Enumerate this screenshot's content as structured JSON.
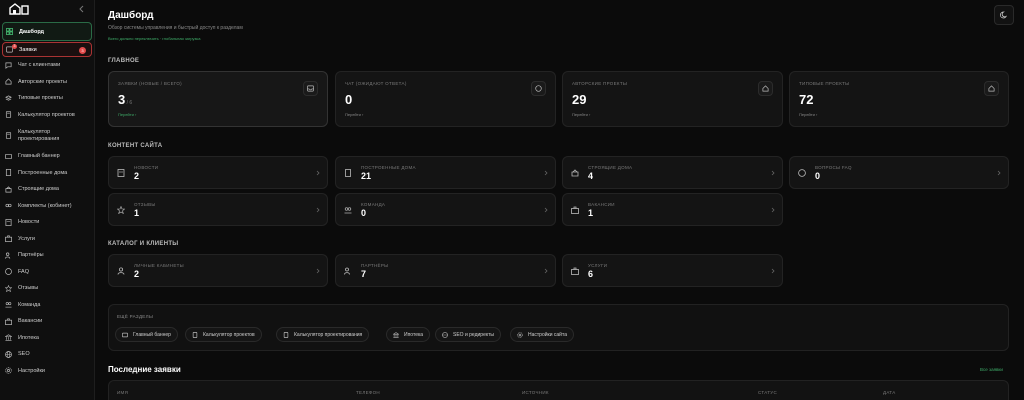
{
  "sidebar": {
    "items": [
      {
        "label": "Дашборд",
        "icon": "dashboard-icon"
      },
      {
        "label": "Заявки",
        "icon": "inbox-icon",
        "badge": "3",
        "count": "3"
      },
      {
        "label": "Чат с клиентами",
        "icon": "chat-icon"
      },
      {
        "label": "Авторские проекты",
        "icon": "home-icon"
      },
      {
        "label": "Типовые проекты",
        "icon": "layers-icon"
      },
      {
        "label": "Калькулятор проектов",
        "icon": "calculator-icon"
      },
      {
        "label": "Калькулятор проектирования",
        "icon": "calculator-icon"
      },
      {
        "label": "Главный баннер",
        "icon": "banner-icon"
      },
      {
        "label": "Построенные дома",
        "icon": "building-icon"
      },
      {
        "label": "Строящие дома",
        "icon": "crane-icon"
      },
      {
        "label": "Комплекты (кобинет)",
        "icon": "box-icon"
      },
      {
        "label": "Новости",
        "icon": "newspaper-icon"
      },
      {
        "label": "Услуги",
        "icon": "briefcase-icon"
      },
      {
        "label": "Партнёры",
        "icon": "users-icon"
      },
      {
        "label": "FAQ",
        "icon": "help-icon"
      },
      {
        "label": "Отзывы",
        "icon": "star-icon"
      },
      {
        "label": "Команда",
        "icon": "team-icon"
      },
      {
        "label": "Вакансии",
        "icon": "briefcase-icon"
      },
      {
        "label": "Ипотека",
        "icon": "bank-icon"
      },
      {
        "label": "SEO",
        "icon": "globe-icon"
      },
      {
        "label": "Настройки",
        "icon": "gear-icon"
      }
    ]
  },
  "header": {
    "title": "Дашборд",
    "subtitle": "Обзор системы управления и быстрый доступ к разделам",
    "update": "Всего должно переключить · глобальная загрузка"
  },
  "sections": {
    "main": "ГЛАВНОЕ",
    "content": "КОНТЕНТ САЙТА",
    "catalog": "КАТАЛОГ И КЛИЕНТЫ"
  },
  "stats": [
    {
      "label": "ЗАЯВКИ (НОВЫЕ / ВСЕГО)",
      "value": "3",
      "sub": "/ 6",
      "more": "Перейти ›"
    },
    {
      "label": "ЧАТ (ОЖИДАЮТ ОТВЕТА)",
      "value": "0",
      "sub": "",
      "more": "Перейти ›"
    },
    {
      "label": "АВТОРСКИЕ ПРОЕКТЫ",
      "value": "29",
      "sub": "",
      "more": "Перейти ›"
    },
    {
      "label": "ТИПОВЫЕ ПРОЕКТЫ",
      "value": "72",
      "sub": "",
      "more": "Перейти ›"
    }
  ],
  "content_cards": [
    {
      "label": "НОВОСТИ",
      "value": "2"
    },
    {
      "label": "ПОСТРОЕННЫЕ ДОМА",
      "value": "21"
    },
    {
      "label": "СТРОЯЩИЕ ДОМА",
      "value": "4"
    },
    {
      "label": "ВОПРОСЫ FAQ",
      "value": "0"
    },
    {
      "label": "ОТЗЫВЫ",
      "value": "1"
    },
    {
      "label": "КОМАНДА",
      "value": "0"
    },
    {
      "label": "ВАКАНСИИ",
      "value": "1"
    }
  ],
  "catalog_cards": [
    {
      "label": "ЛИЧНЫЕ КАБИНЕТЫ",
      "value": "2"
    },
    {
      "label": "ПАРТНЁРЫ",
      "value": "7"
    },
    {
      "label": "УСЛУГИ",
      "value": "6"
    }
  ],
  "more_sections": {
    "title": "ЕЩЁ РАЗДЕЛЫ",
    "chips": [
      "Главный баннер",
      "Калькулятор проектов",
      "Калькулятор проектирования",
      "Ипотека",
      "SEO и редиректы",
      "Настройки сайта"
    ]
  },
  "recent": {
    "title": "Последние заявки",
    "all_link": "Все заявки",
    "columns": [
      "ИМЯ",
      "ТЕЛЕФОН",
      "ИСТОЧНИК",
      "СТАТУС",
      "ДАТА"
    ]
  }
}
